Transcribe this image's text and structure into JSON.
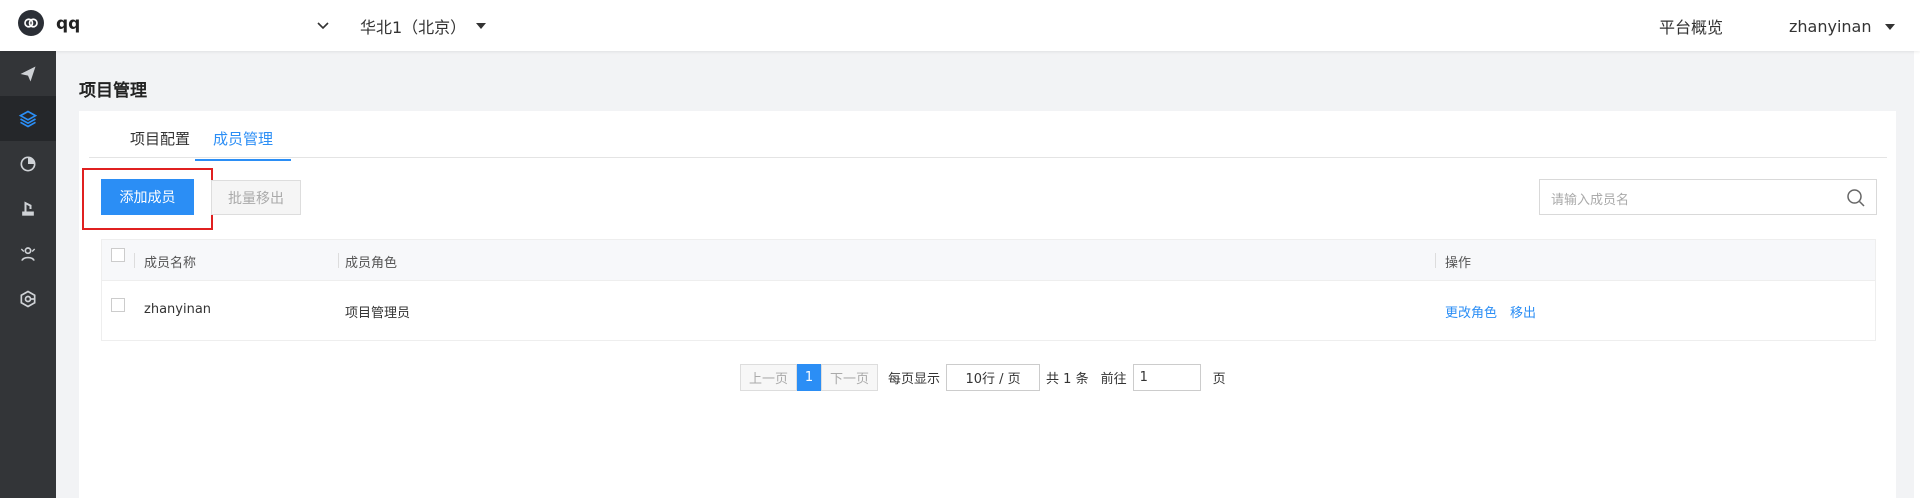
{
  "header": {
    "project_name": "qq",
    "region": "华北1（北京）",
    "overview": "平台概览",
    "username": "zhanyinan"
  },
  "sidebar": {
    "items": [
      {
        "icon": "send-icon"
      },
      {
        "icon": "layers-icon",
        "active": true
      },
      {
        "icon": "pie-chart-icon"
      },
      {
        "icon": "robot-arm-icon"
      },
      {
        "icon": "users-icon"
      },
      {
        "icon": "gear-network-icon"
      }
    ]
  },
  "page": {
    "title": "项目管理",
    "tabs": [
      {
        "label": "项目配置"
      },
      {
        "label": "成员管理",
        "active": true
      }
    ]
  },
  "toolbar": {
    "add_label": "添加成员",
    "remove_label": "批量移出",
    "search_placeholder": "请输入成员名"
  },
  "table": {
    "columns": [
      "成员名称",
      "成员角色",
      "操作"
    ],
    "rows": [
      {
        "name": "zhanyinan",
        "role": "项目管理员",
        "actions": [
          "更改角色",
          "移出"
        ]
      }
    ]
  },
  "pagination": {
    "prev": "上一页",
    "current": "1",
    "next": "下一页",
    "per_page_label": "每页显示",
    "per_page_value": "10行 / 页",
    "total": "共 1 条",
    "goto_label": "前往",
    "goto_value": "1",
    "page_suffix": "页"
  },
  "colors": {
    "accent": "#2b8ef5",
    "sidebar_bg": "#333538",
    "highlight": "#e02020"
  }
}
